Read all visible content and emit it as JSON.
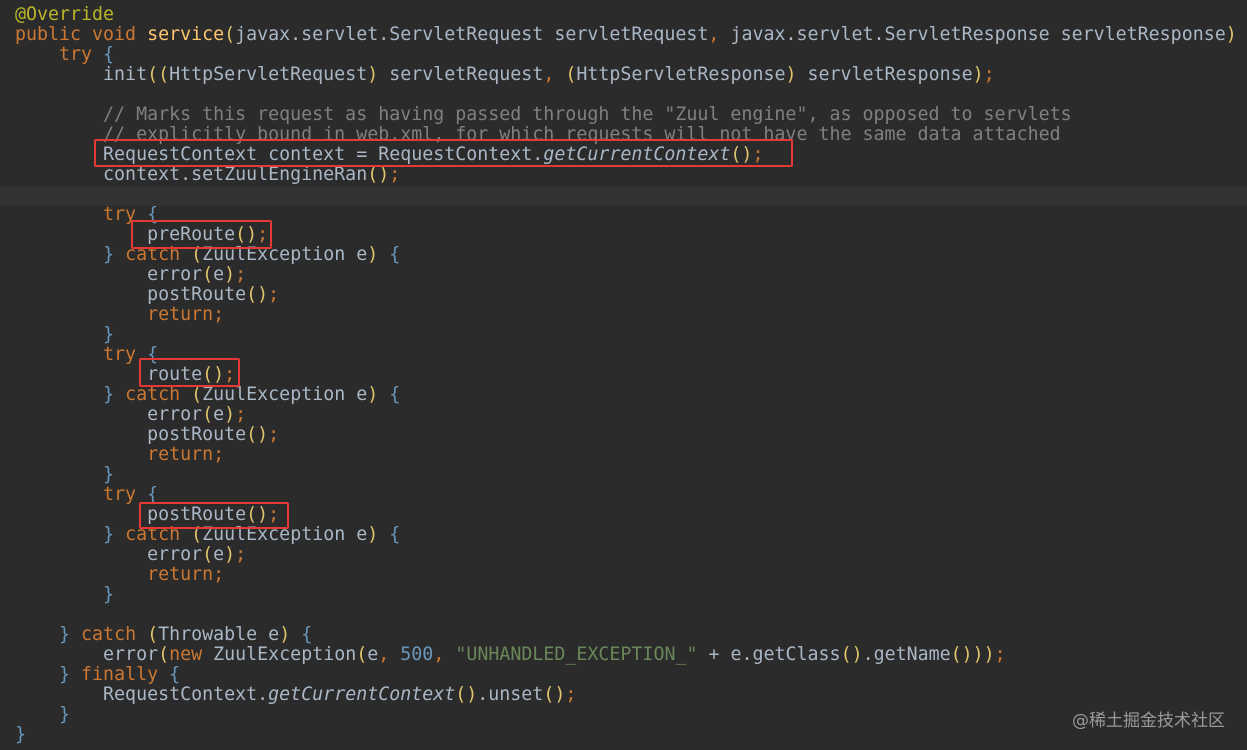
{
  "code_lines": [
    {
      "tokens": [
        {
          "t": "@Override",
          "c": "an"
        }
      ]
    },
    {
      "tokens": [
        {
          "t": "public void ",
          "c": "kw"
        },
        {
          "t": "service",
          "c": "fn"
        },
        {
          "t": "(",
          "c": "par"
        },
        {
          "t": "javax.servlet.ServletRequest servletRequest",
          "c": ""
        },
        {
          "t": ", ",
          "c": "kw"
        },
        {
          "t": "javax.servlet.ServletResponse servletResponse",
          "c": ""
        },
        {
          "t": ")",
          "c": "par"
        }
      ]
    },
    {
      "tokens": [
        {
          "t": "    try ",
          "c": "kw"
        },
        {
          "t": "{",
          "c": "br"
        }
      ]
    },
    {
      "tokens": [
        {
          "t": "        init",
          "c": ""
        },
        {
          "t": "((",
          "c": "par"
        },
        {
          "t": "HttpServletRequest",
          "c": ""
        },
        {
          "t": ") ",
          "c": "par"
        },
        {
          "t": "servletRequest",
          "c": ""
        },
        {
          "t": ", ",
          "c": "kw"
        },
        {
          "t": "(",
          "c": "par"
        },
        {
          "t": "HttpServletResponse",
          "c": ""
        },
        {
          "t": ") ",
          "c": "par"
        },
        {
          "t": "servletResponse",
          "c": ""
        },
        {
          "t": ")",
          "c": "par"
        },
        {
          "t": ";",
          "c": "kw"
        }
      ]
    },
    {
      "tokens": [
        {
          "t": "",
          "c": ""
        }
      ]
    },
    {
      "tokens": [
        {
          "t": "        // Marks this request as having passed through the \"Zuul engine\", as opposed to servlets",
          "c": "cm"
        }
      ]
    },
    {
      "tokens": [
        {
          "t": "        // explicitly bound in web.xml, for which requests will not have the same data attached",
          "c": "cm"
        }
      ]
    },
    {
      "tokens": [
        {
          "t": "        RequestContext context = RequestContext.",
          "c": ""
        },
        {
          "t": "getCurrentContext",
          "c": "it"
        },
        {
          "t": "()",
          "c": "par"
        },
        {
          "t": ";",
          "c": "kw"
        }
      ]
    },
    {
      "tokens": [
        {
          "t": "        context.setZuulEngineRan",
          "c": ""
        },
        {
          "t": "()",
          "c": "par"
        },
        {
          "t": ";",
          "c": "kw"
        }
      ]
    },
    {
      "tokens": [
        {
          "t": "",
          "c": ""
        }
      ]
    },
    {
      "tokens": [
        {
          "t": "        try ",
          "c": "kw"
        },
        {
          "t": "{",
          "c": "br"
        }
      ]
    },
    {
      "tokens": [
        {
          "t": "            preRoute",
          "c": ""
        },
        {
          "t": "()",
          "c": "par"
        },
        {
          "t": ";",
          "c": "kw"
        }
      ]
    },
    {
      "tokens": [
        {
          "t": "        ",
          "c": ""
        },
        {
          "t": "} ",
          "c": "br"
        },
        {
          "t": "catch ",
          "c": "kw"
        },
        {
          "t": "(",
          "c": "par"
        },
        {
          "t": "ZuulException e",
          "c": ""
        },
        {
          "t": ") ",
          "c": "par"
        },
        {
          "t": "{",
          "c": "br"
        }
      ]
    },
    {
      "tokens": [
        {
          "t": "            error",
          "c": ""
        },
        {
          "t": "(",
          "c": "par"
        },
        {
          "t": "e",
          "c": ""
        },
        {
          "t": ")",
          "c": "par"
        },
        {
          "t": ";",
          "c": "kw"
        }
      ]
    },
    {
      "tokens": [
        {
          "t": "            postRoute",
          "c": ""
        },
        {
          "t": "()",
          "c": "par"
        },
        {
          "t": ";",
          "c": "kw"
        }
      ]
    },
    {
      "tokens": [
        {
          "t": "            return;",
          "c": "kw"
        }
      ]
    },
    {
      "tokens": [
        {
          "t": "        }",
          "c": "br"
        }
      ]
    },
    {
      "tokens": [
        {
          "t": "        try ",
          "c": "kw"
        },
        {
          "t": "{",
          "c": "br"
        }
      ]
    },
    {
      "tokens": [
        {
          "t": "            route",
          "c": ""
        },
        {
          "t": "()",
          "c": "par"
        },
        {
          "t": ";",
          "c": "kw"
        }
      ]
    },
    {
      "tokens": [
        {
          "t": "        ",
          "c": ""
        },
        {
          "t": "} ",
          "c": "br"
        },
        {
          "t": "catch ",
          "c": "kw"
        },
        {
          "t": "(",
          "c": "par"
        },
        {
          "t": "ZuulException e",
          "c": ""
        },
        {
          "t": ") ",
          "c": "par"
        },
        {
          "t": "{",
          "c": "br"
        }
      ]
    },
    {
      "tokens": [
        {
          "t": "            error",
          "c": ""
        },
        {
          "t": "(",
          "c": "par"
        },
        {
          "t": "e",
          "c": ""
        },
        {
          "t": ")",
          "c": "par"
        },
        {
          "t": ";",
          "c": "kw"
        }
      ]
    },
    {
      "tokens": [
        {
          "t": "            postRoute",
          "c": ""
        },
        {
          "t": "()",
          "c": "par"
        },
        {
          "t": ";",
          "c": "kw"
        }
      ]
    },
    {
      "tokens": [
        {
          "t": "            return;",
          "c": "kw"
        }
      ]
    },
    {
      "tokens": [
        {
          "t": "        }",
          "c": "br"
        }
      ]
    },
    {
      "tokens": [
        {
          "t": "        try ",
          "c": "kw"
        },
        {
          "t": "{",
          "c": "br"
        }
      ]
    },
    {
      "tokens": [
        {
          "t": "            postRoute",
          "c": ""
        },
        {
          "t": "()",
          "c": "par"
        },
        {
          "t": ";",
          "c": "kw"
        }
      ]
    },
    {
      "tokens": [
        {
          "t": "        ",
          "c": ""
        },
        {
          "t": "} ",
          "c": "br"
        },
        {
          "t": "catch ",
          "c": "kw"
        },
        {
          "t": "(",
          "c": "par"
        },
        {
          "t": "ZuulException e",
          "c": ""
        },
        {
          "t": ") ",
          "c": "par"
        },
        {
          "t": "{",
          "c": "br"
        }
      ]
    },
    {
      "tokens": [
        {
          "t": "            error",
          "c": ""
        },
        {
          "t": "(",
          "c": "par"
        },
        {
          "t": "e",
          "c": ""
        },
        {
          "t": ")",
          "c": "par"
        },
        {
          "t": ";",
          "c": "kw"
        }
      ]
    },
    {
      "tokens": [
        {
          "t": "            return;",
          "c": "kw"
        }
      ]
    },
    {
      "tokens": [
        {
          "t": "        }",
          "c": "br"
        }
      ]
    },
    {
      "tokens": [
        {
          "t": "",
          "c": ""
        }
      ]
    },
    {
      "tokens": [
        {
          "t": "    ",
          "c": ""
        },
        {
          "t": "} ",
          "c": "br"
        },
        {
          "t": "catch ",
          "c": "kw"
        },
        {
          "t": "(",
          "c": "par"
        },
        {
          "t": "Throwable e",
          "c": ""
        },
        {
          "t": ") ",
          "c": "par"
        },
        {
          "t": "{",
          "c": "br"
        }
      ]
    },
    {
      "tokens": [
        {
          "t": "        error",
          "c": ""
        },
        {
          "t": "(",
          "c": "par"
        },
        {
          "t": "new ",
          "c": "kw"
        },
        {
          "t": "ZuulException",
          "c": ""
        },
        {
          "t": "(",
          "c": "par"
        },
        {
          "t": "e",
          "c": ""
        },
        {
          "t": ", ",
          "c": "kw"
        },
        {
          "t": "500",
          "c": "num"
        },
        {
          "t": ", ",
          "c": "kw"
        },
        {
          "t": "\"UNHANDLED_EXCEPTION_\"",
          "c": "str"
        },
        {
          "t": " + e.getClass",
          "c": ""
        },
        {
          "t": "()",
          "c": "par"
        },
        {
          "t": ".getName",
          "c": ""
        },
        {
          "t": "()))",
          "c": "par"
        },
        {
          "t": ";",
          "c": "kw"
        }
      ]
    },
    {
      "tokens": [
        {
          "t": "    ",
          "c": ""
        },
        {
          "t": "} ",
          "c": "br"
        },
        {
          "t": "finally ",
          "c": "kw"
        },
        {
          "t": "{",
          "c": "br"
        }
      ]
    },
    {
      "tokens": [
        {
          "t": "        RequestContext.",
          "c": ""
        },
        {
          "t": "getCurrentContext",
          "c": "it"
        },
        {
          "t": "()",
          "c": "par"
        },
        {
          "t": ".unset",
          "c": ""
        },
        {
          "t": "()",
          "c": "par"
        },
        {
          "t": ";",
          "c": "kw"
        }
      ]
    },
    {
      "tokens": [
        {
          "t": "    }",
          "c": "br"
        }
      ]
    },
    {
      "tokens": [
        {
          "t": "}",
          "c": "br"
        }
      ]
    }
  ],
  "highlight_boxes": [
    {
      "label": "RequestContext context = RequestContext.getCurrentContext();"
    },
    {
      "label": "preRoute();"
    },
    {
      "label": "route();"
    },
    {
      "label": "postRoute();"
    }
  ],
  "watermark": "@稀土掘金技术社区",
  "colors": {
    "background": "#2b2b2b",
    "keyword": "#cc7832",
    "annotation": "#bbb529",
    "method": "#ffc66d",
    "comment": "#808080",
    "string": "#6a8759",
    "number": "#6897bb",
    "highlight_box": "#e53935"
  }
}
